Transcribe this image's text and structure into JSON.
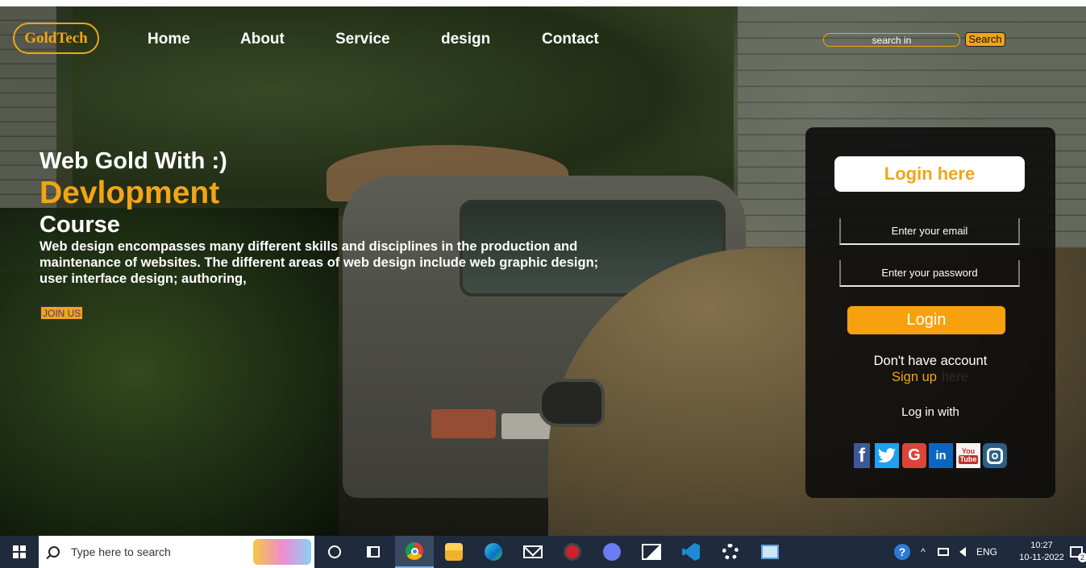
{
  "header": {
    "logo": "GoldTech",
    "nav": [
      {
        "label": "Home"
      },
      {
        "label": "About"
      },
      {
        "label": "Service"
      },
      {
        "label": "design"
      },
      {
        "label": "Contact"
      }
    ],
    "search": {
      "placeholder": "search in",
      "button_label": "Search"
    }
  },
  "hero": {
    "line1": "Web Gold With :)",
    "line2": "Devlopment",
    "line3": "Course",
    "description": "Web design encompasses many different skills and disciplines in the production and maintenance of websites. The different areas of web design include web graphic design; user interface design; authoring,",
    "join_label": "JOIN US"
  },
  "login": {
    "title": "Login here",
    "email_placeholder": "Enter your email",
    "password_placeholder": "Enter your password",
    "button_label": "Login",
    "no_account": "Don't have account",
    "signup_label": "Sign up",
    "signup_suffix": "here",
    "login_with": "Log in with",
    "socials": [
      "facebook-icon",
      "twitter-icon",
      "google-icon",
      "linkedin-icon",
      "youtube-icon",
      "instagram-icon"
    ],
    "fb_glyph": "f",
    "tw_glyph": "t",
    "google_glyph": "G",
    "linkedin_glyph": "in",
    "youtube_top": "You",
    "youtube_bottom": "Tube"
  },
  "taskbar": {
    "search_placeholder": "Type here to search",
    "language": "ENG",
    "time": "10:27",
    "date": "10-11-2022",
    "notification_count": "2"
  },
  "colors": {
    "accent": "#f2a516",
    "taskbar": "#1f2a3c"
  }
}
